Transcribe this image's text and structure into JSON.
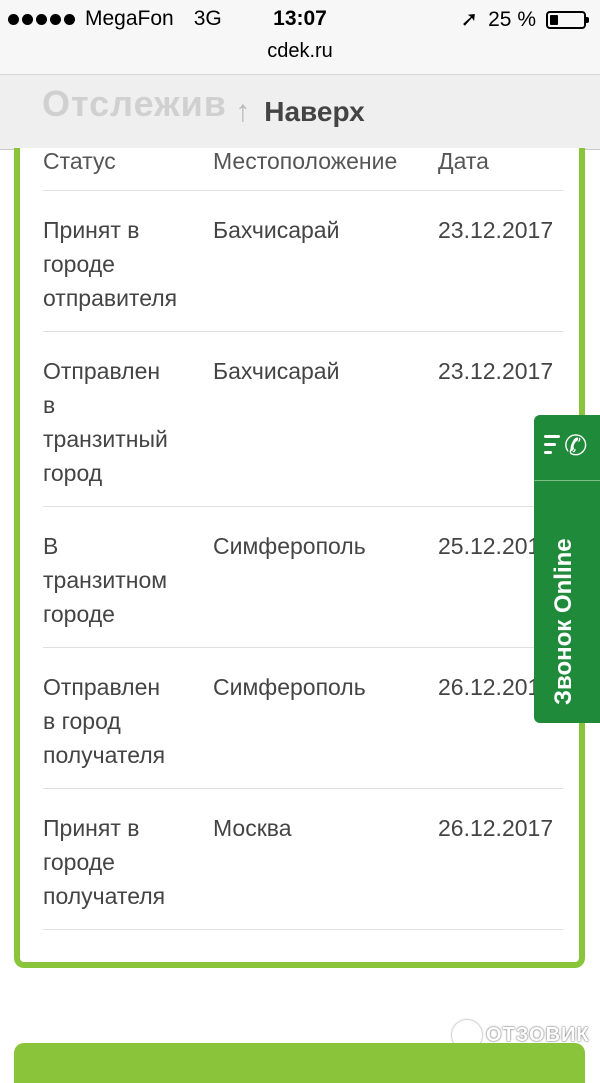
{
  "status_bar": {
    "carrier": "MegaFon",
    "network": "3G",
    "time": "13:07",
    "battery": "25 %",
    "battery_level": 0.25
  },
  "url": "cdek.ru",
  "header": {
    "ghost_text": "Отслежив",
    "up_label": "Наверх"
  },
  "table": {
    "headers": [
      "Статус",
      "Местоположение",
      "Дата"
    ],
    "rows": [
      {
        "status": "Принят в\nгороде\nотправителя",
        "location": "Бахчисарай",
        "date": "23.12.2017"
      },
      {
        "status": "Отправлен\nв\nтранзитный\nгород",
        "location": "Бахчисарай",
        "date": "23.12.2017"
      },
      {
        "status": "В\nтранзитном\nгороде",
        "location": "Симферополь",
        "date": "25.12.2017"
      },
      {
        "status": "Отправлен\nв город\nполучателя",
        "location": "Симферополь",
        "date": "26.12.2017"
      },
      {
        "status": "Принят в\nгороде\nполучателя",
        "location": "Москва",
        "date": "26.12.2017"
      }
    ]
  },
  "callback": {
    "label": "Звонок Online",
    "icon": "phone-callback-icon"
  },
  "watermark": "ОТЗОВИК",
  "colors": {
    "accent_green": "#8ac43b",
    "callback_green": "#1f8a3a"
  }
}
